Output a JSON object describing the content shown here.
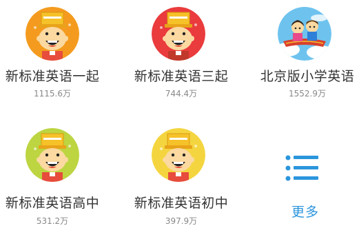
{
  "books": [
    {
      "title": "新标准英语一起",
      "count": "1115.6万",
      "avatar_color": "#f49b1f",
      "icon": "cartoon-boy-icon"
    },
    {
      "title": "新标准英语三起",
      "count": "744.4万",
      "avatar_color": "#ea3b3d",
      "icon": "cartoon-boy-icon"
    },
    {
      "title": "北京版小学英语",
      "count": "1552.9万",
      "avatar_color": "#5cb8e6",
      "icon": "flying-carpet-kids-icon"
    },
    {
      "title": "新标准英语高中",
      "count": "531.2万",
      "avatar_color": "#bcd541",
      "icon": "cartoon-boy-icon"
    },
    {
      "title": "新标准英语初中",
      "count": "397.9万",
      "avatar_color": "#f4d540",
      "icon": "cartoon-boy-icon"
    }
  ],
  "more": {
    "label": "更多",
    "icon": "list-icon",
    "color": "#2b95dc"
  }
}
